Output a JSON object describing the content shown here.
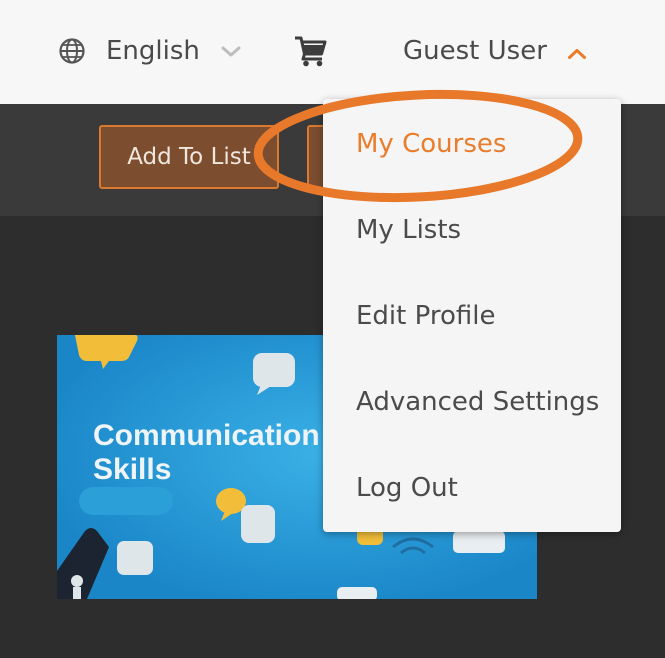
{
  "header": {
    "language_label": "English",
    "user_label": "Guest User"
  },
  "actions": {
    "add_to_list_label": "Add To List"
  },
  "course_thumbnail": {
    "title_line1": "Communication",
    "title_line2": "Skills"
  },
  "user_menu": {
    "items": [
      {
        "label": "My Courses",
        "active": true
      },
      {
        "label": "My Lists"
      },
      {
        "label": "Edit Profile"
      },
      {
        "label": "Advanced Settings"
      },
      {
        "label": "Log Out"
      }
    ]
  },
  "icons": {
    "language": "globe-icon",
    "language_toggle": "chevron-down-icon",
    "cart": "cart-icon",
    "user_toggle": "chevron-up-icon"
  },
  "colors": {
    "accent": "#e97d2b",
    "highlight_ring": "#e8792a",
    "topbar_bg": "#f7f7f7",
    "dark_bg": "#2d2d2d",
    "button_bg": "#7c4d2e"
  }
}
